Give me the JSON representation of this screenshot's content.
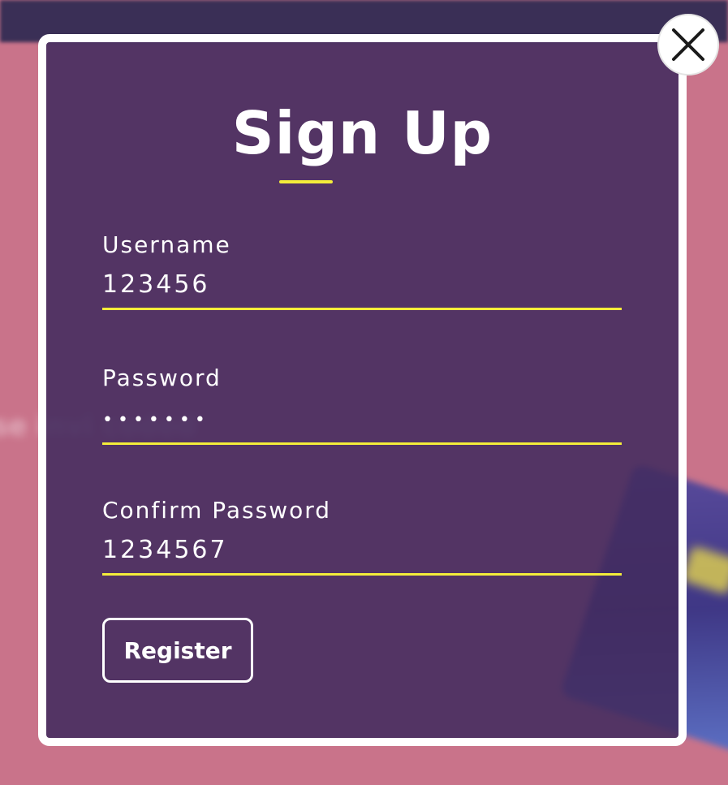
{
  "background": {
    "blurred_text": "se invi  coded"
  },
  "modal": {
    "title": "Sign Up",
    "fields": [
      {
        "label": "Username",
        "value": "123456"
      },
      {
        "label": "Password",
        "value": "•••••••"
      },
      {
        "label": "Confirm Password",
        "value": "1234567"
      }
    ],
    "register_label": "Register"
  },
  "icons": {
    "close": "close-icon"
  },
  "colors": {
    "accent": "#f4ed3a",
    "modal_bg": "#422b5e",
    "page_bg": "#c9738a",
    "topbar": "#3a2f56"
  }
}
